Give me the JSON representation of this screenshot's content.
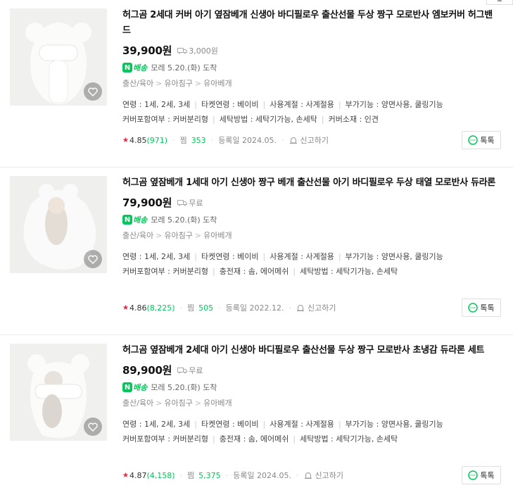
{
  "accent_color": "#03c75a",
  "products": [
    {
      "title": "허그곰 2세대 커버 아기 옆잠베개 신생아 바디필로우 출산선물 두상 짱구 모로반사 엠보커버 허그밴드",
      "price": "39,900원",
      "shipping": "3,000원",
      "delivery_badge": "배송",
      "delivery_badge_letter": "N",
      "delivery_text": "모레 5.20.(화) 도착",
      "category": [
        "출산/육아",
        "유아침구",
        "유아베개"
      ],
      "specs_line1": [
        "연령 : 1세, 2세, 3세",
        "타켓연령 : 베이비",
        "사용계절 : 사계절용",
        "부가기능 : 양면사용, 쿨링기능"
      ],
      "specs_line2": [
        "커버포함여부 : 커버분리형",
        "세탁방법 : 세탁기가능, 손세탁",
        "커버소재 : 인견"
      ],
      "rating": "4.85",
      "review_count": "(971)",
      "zzim_label": "찜",
      "zzim_count": "353",
      "registered": "등록일 2024.05.",
      "report_label": "신고하기",
      "talk_label": "톡톡"
    },
    {
      "title": "허그곰 옆잠베개 1세대 아기 신생아 짱구 베개 출산선물 아기 바디필로우 두상 태열 모로반사 듀라론",
      "price": "79,900원",
      "shipping": "무료",
      "delivery_badge": "배송",
      "delivery_badge_letter": "N",
      "delivery_text": "모레 5.20.(화) 도착",
      "category": [
        "출산/육아",
        "유아침구",
        "유아베개"
      ],
      "specs_line1": [
        "연령 : 1세, 2세, 3세",
        "타켓연령 : 베이비",
        "사용계절 : 사계절용",
        "부가기능 : 양면사용, 쿨링기능"
      ],
      "specs_line2": [
        "커버포함여부 : 커버분리형",
        "충전재 : 솜, 에어메쉬",
        "세탁방법 : 세탁기가능, 손세탁"
      ],
      "rating": "4.86",
      "review_count": "(8,225)",
      "zzim_label": "찜",
      "zzim_count": "505",
      "registered": "등록일 2022.12.",
      "report_label": "신고하기",
      "talk_label": "톡톡"
    },
    {
      "title": "허그곰 옆잠베개 2세대 아기 신생아 바디필로우 출산선물 두상 짱구 모로반사 초냉감 듀라론 세트",
      "price": "89,900원",
      "shipping": "무료",
      "delivery_badge": "배송",
      "delivery_badge_letter": "N",
      "delivery_text": "모레 5.20.(화) 도착",
      "category": [
        "출산/육아",
        "유아침구",
        "유아베개"
      ],
      "specs_line1": [
        "연령 : 1세, 2세, 3세",
        "타켓연령 : 베이비",
        "사용계절 : 사계절용",
        "부가기능 : 양면사용, 쿨링기능"
      ],
      "specs_line2": [
        "커버포함여부 : 커버분리형",
        "충전재 : 솜, 에어메쉬",
        "세탁방법 : 세탁기가능, 손세탁"
      ],
      "rating": "4.87",
      "review_count": "(4,158)",
      "zzim_label": "찜",
      "zzim_count": "5,375",
      "registered": "등록일 2024.05.",
      "report_label": "신고하기",
      "talk_label": "톡톡"
    }
  ]
}
